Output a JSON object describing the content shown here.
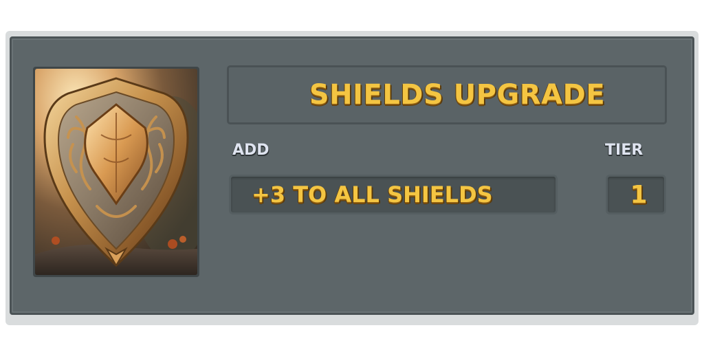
{
  "card": {
    "title": "SHIELDS UPGRADE",
    "add_label": "ADD",
    "add_value": "+3 TO ALL SHIELDS",
    "tier_label": "TIER",
    "tier_value": "1",
    "art_icon": "ornate-golden-shield-icon"
  },
  "colors": {
    "panel": "#5d6669",
    "panel_dark": "#4a5254",
    "gold_text": "#f4c542",
    "label_text": "#dfe4f0"
  }
}
